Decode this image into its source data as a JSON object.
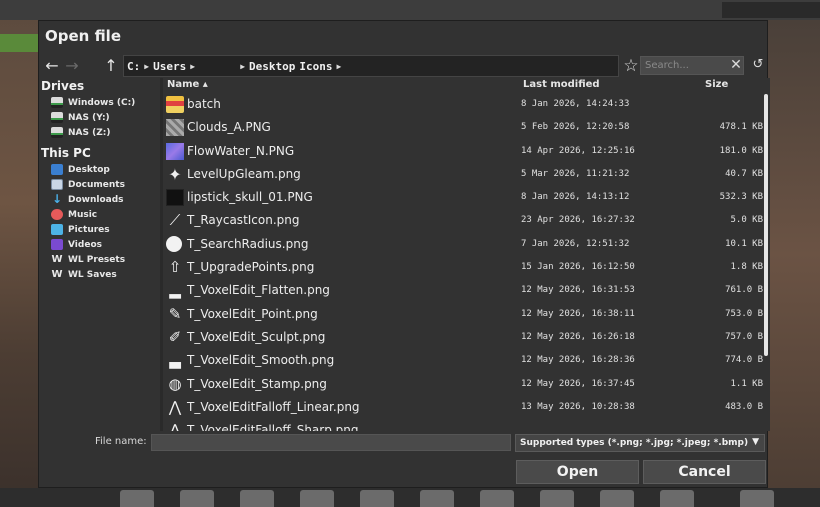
{
  "dialog": {
    "title": "Open file",
    "path": [
      "C:",
      "Users",
      "",
      "Desktop",
      "Icons"
    ],
    "search_placeholder": "Search...",
    "file_name_label": "File name:",
    "file_name_value": "",
    "file_types": "Supported types (*.png; *.jpg; *.jpeg; *.bmp)",
    "open_label": "Open",
    "cancel_label": "Cancel"
  },
  "sidebar": {
    "drives_heading": "Drives",
    "drives": [
      {
        "label": "Windows (C:)",
        "icon": "drive-icon"
      },
      {
        "label": "NAS (Y:)",
        "icon": "drive-icon"
      },
      {
        "label": "NAS (Z:)",
        "icon": "drive-icon"
      }
    ],
    "pc_heading": "This PC",
    "places": [
      {
        "label": "Desktop",
        "icon": "desktop-icon"
      },
      {
        "label": "Documents",
        "icon": "documents-icon"
      },
      {
        "label": "Downloads",
        "icon": "download-icon"
      },
      {
        "label": "Music",
        "icon": "music-icon"
      },
      {
        "label": "Pictures",
        "icon": "pictures-icon"
      },
      {
        "label": "Videos",
        "icon": "videos-icon"
      },
      {
        "label": "WL Presets",
        "icon": "wl-icon"
      },
      {
        "label": "WL Saves",
        "icon": "wl-icon"
      }
    ]
  },
  "columns": {
    "name": "Name ▴",
    "modified": "Last modified",
    "size": "Size"
  },
  "files": [
    {
      "name": "batch",
      "modified": "8 Jan 2026, 14:24:33",
      "size": "",
      "icon": "folder"
    },
    {
      "name": "Clouds_A.PNG",
      "modified": "5 Feb 2026, 12:20:58",
      "size": "478.1 KB",
      "icon": "clouds"
    },
    {
      "name": "FlowWater_N.PNG",
      "modified": "14 Apr 2026, 12:25:16",
      "size": "181.0 KB",
      "icon": "water"
    },
    {
      "name": "LevelUpGleam.png",
      "modified": "5 Mar 2026, 11:21:32",
      "size": "40.7 KB",
      "icon": "gleam"
    },
    {
      "name": "lipstick_skull_01.PNG",
      "modified": "8 Jan 2026, 14:13:12",
      "size": "532.3 KB",
      "icon": "skull"
    },
    {
      "name": "T_RaycastIcon.png",
      "modified": "23 Apr 2026, 16:27:32",
      "size": "5.0 KB",
      "icon": "raycast"
    },
    {
      "name": "T_SearchRadius.png",
      "modified": "7 Jan 2026, 12:51:32",
      "size": "10.1 KB",
      "icon": "circle"
    },
    {
      "name": "T_UpgradePoints.png",
      "modified": "15 Jan 2026, 16:12:50",
      "size": "1.8 KB",
      "icon": "upgrade"
    },
    {
      "name": "T_VoxelEdit_Flatten.png",
      "modified": "12 May 2026, 16:31:53",
      "size": "761.0 B",
      "icon": "flatten"
    },
    {
      "name": "T_VoxelEdit_Point.png",
      "modified": "12 May 2026, 16:38:11",
      "size": "753.0 B",
      "icon": "brush"
    },
    {
      "name": "T_VoxelEdit_Sculpt.png",
      "modified": "12 May 2026, 16:26:18",
      "size": "757.0 B",
      "icon": "sculpt"
    },
    {
      "name": "T_VoxelEdit_Smooth.png",
      "modified": "12 May 2026, 16:28:36",
      "size": "774.0 B",
      "icon": "smooth"
    },
    {
      "name": "T_VoxelEdit_Stamp.png",
      "modified": "12 May 2026, 16:37:45",
      "size": "1.1 KB",
      "icon": "stamp"
    },
    {
      "name": "T_VoxelEditFalloff_Linear.png",
      "modified": "13 May 2026, 10:28:38",
      "size": "483.0 B",
      "icon": "linear"
    },
    {
      "name": "T_VoxelEditFalloff_Sharp.png",
      "modified": "",
      "size": "",
      "icon": "sharp"
    }
  ]
}
